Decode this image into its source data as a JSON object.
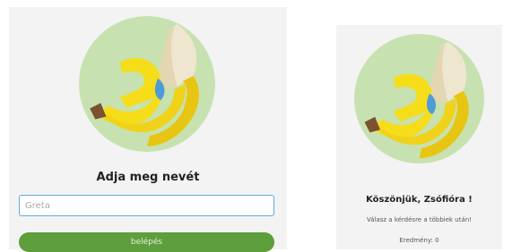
{
  "login": {
    "prompt": "Adja meg nevét",
    "name_placeholder": "Greta",
    "button_label": "belépés"
  },
  "result": {
    "thanks": "Köszönjük, Zsófióra !",
    "instruction": "Válasz a kérdésre a többiek után!",
    "score": "Eredmény: 0"
  },
  "colors": {
    "logo_circle": "#c7e2b0",
    "banana_yellow": "#f5dd1a",
    "banana_peel_inner": "#efe6cf",
    "banana_stem": "#7a5232",
    "banana_spot": "#4d9cd6",
    "button_green": "#5e9e3c",
    "input_border": "#5aaee0",
    "panel_bg": "#f3f3f3"
  }
}
